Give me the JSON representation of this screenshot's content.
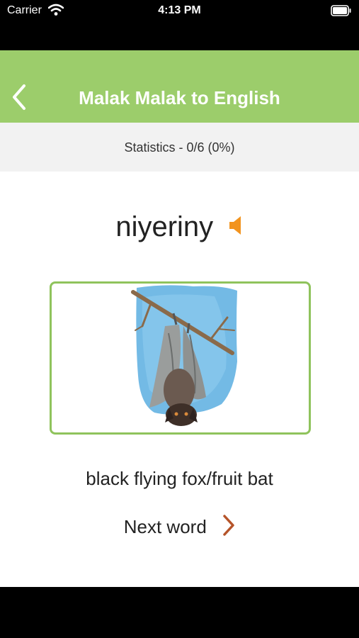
{
  "status_bar": {
    "carrier": "Carrier",
    "time": "4:13 PM"
  },
  "nav": {
    "title": "Malak Malak to English"
  },
  "stats": {
    "text": "Statistics - 0/6 (0%)"
  },
  "card": {
    "word": "niyeriny",
    "meaning": "black flying fox/fruit bat",
    "next_label": "Next word"
  },
  "colors": {
    "nav_green": "#9ccd6b",
    "frame_green": "#8fc35c",
    "accent_orange": "#f2941f",
    "chevron_brown": "#b5542a"
  }
}
